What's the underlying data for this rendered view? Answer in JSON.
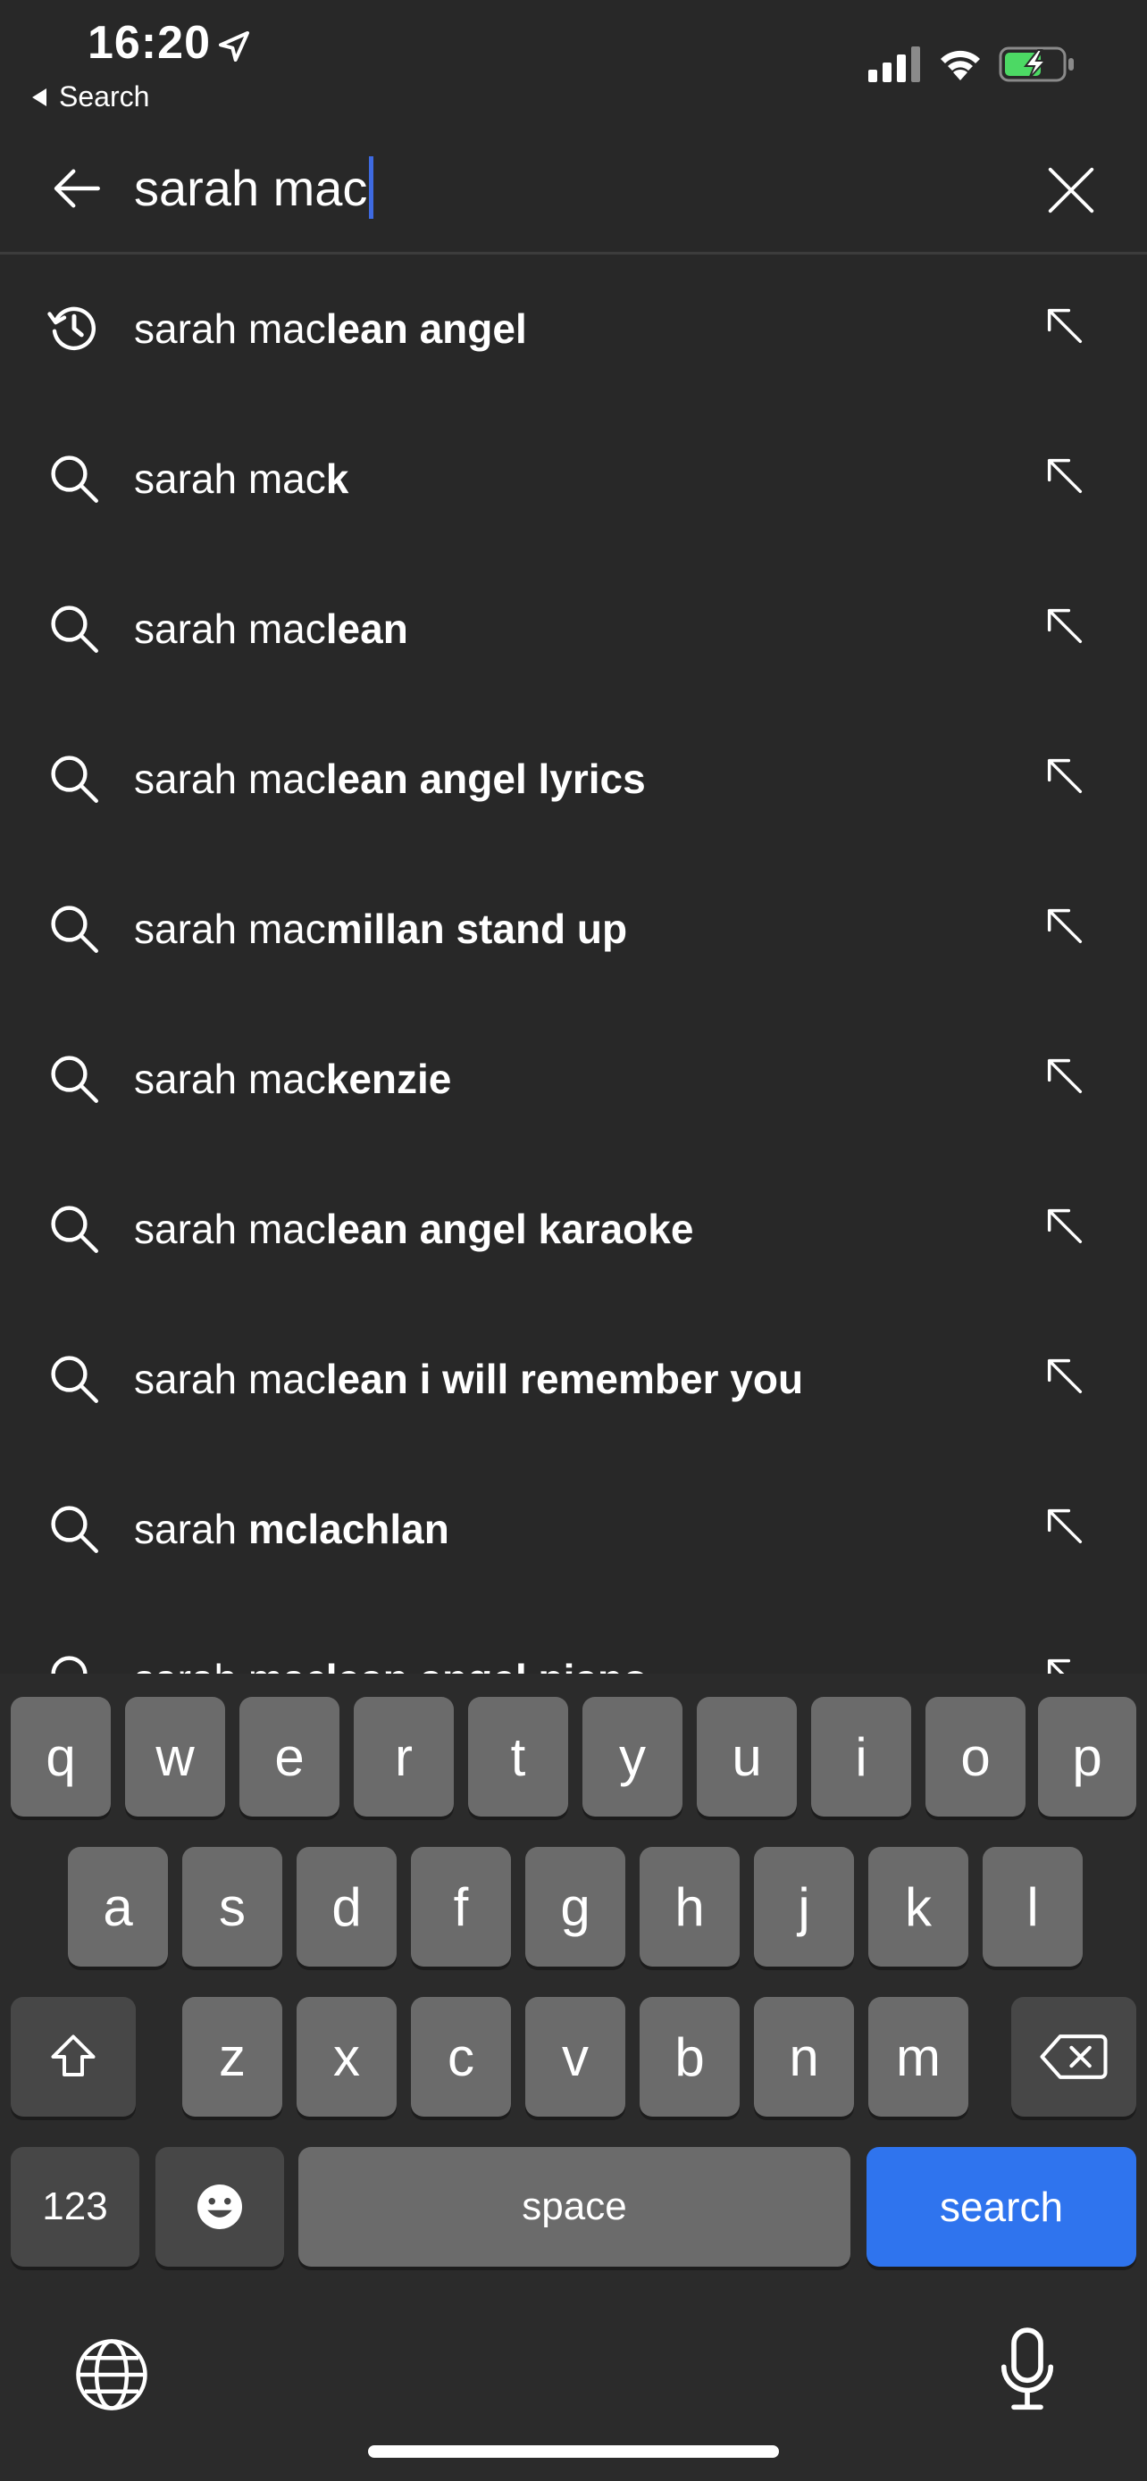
{
  "status_bar": {
    "time": "16:20",
    "back_app_label": "Search"
  },
  "search": {
    "query": "sarah mac"
  },
  "suggestions": [
    {
      "icon": "history-icon",
      "typed": "sarah mac",
      "rest": "lean angel"
    },
    {
      "icon": "search-icon",
      "typed": "sarah mac",
      "rest": "k"
    },
    {
      "icon": "search-icon",
      "typed": "sarah mac",
      "rest": "lean"
    },
    {
      "icon": "search-icon",
      "typed": "sarah mac",
      "rest": "lean angel lyrics"
    },
    {
      "icon": "search-icon",
      "typed": "sarah mac",
      "rest": "millan stand up"
    },
    {
      "icon": "search-icon",
      "typed": "sarah mac",
      "rest": "kenzie"
    },
    {
      "icon": "search-icon",
      "typed": "sarah mac",
      "rest": "lean angel karaoke"
    },
    {
      "icon": "search-icon",
      "typed": "sarah mac",
      "rest": "lean i will remember you"
    },
    {
      "icon": "search-icon",
      "typed": "sarah ",
      "rest": "mclachlan"
    },
    {
      "icon": "search-icon",
      "typed": "sarah mac",
      "rest": "lean angel piano"
    }
  ],
  "keyboard": {
    "row1": [
      "q",
      "w",
      "e",
      "r",
      "t",
      "y",
      "u",
      "i",
      "o",
      "p"
    ],
    "row2": [
      "a",
      "s",
      "d",
      "f",
      "g",
      "h",
      "j",
      "k",
      "l"
    ],
    "row3": [
      "z",
      "x",
      "c",
      "v",
      "b",
      "n",
      "m"
    ],
    "numbers_label": "123",
    "space_label": "space",
    "search_label": "search"
  },
  "colors": {
    "background": "#282828",
    "caret": "#3e6ae1",
    "search_key": "#2f74ee",
    "battery_fill": "#4cd964"
  }
}
